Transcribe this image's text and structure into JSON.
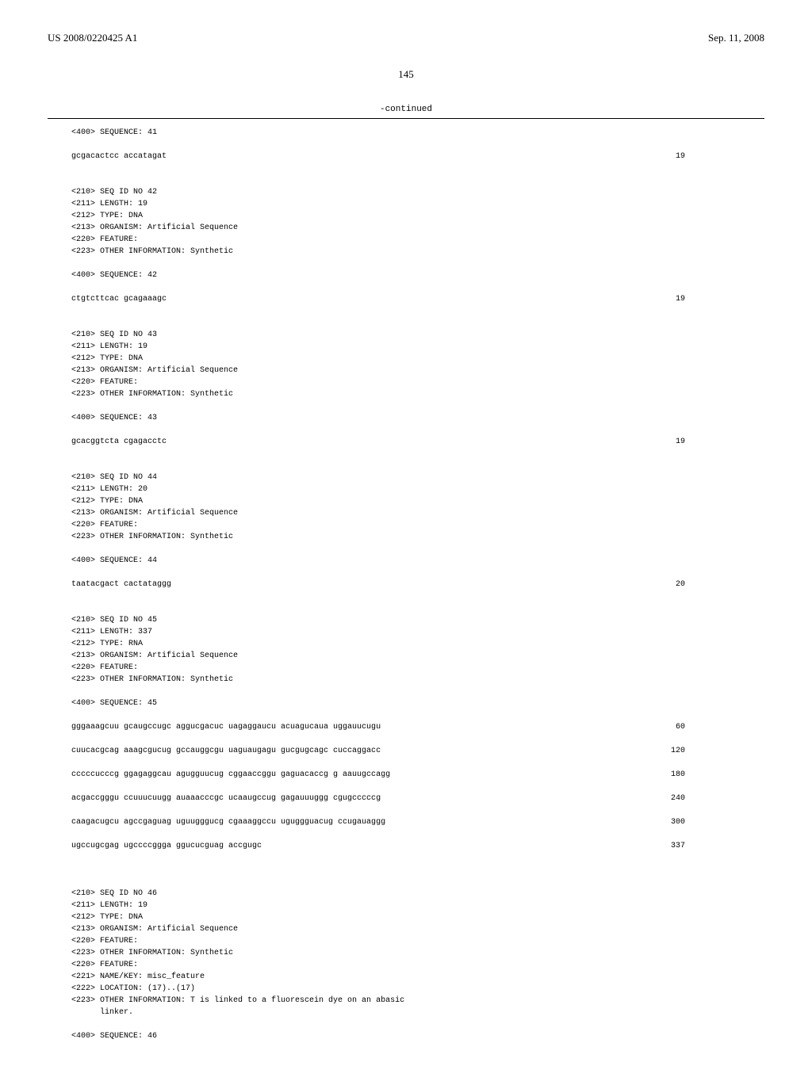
{
  "header": {
    "left": "US 2008/0220425 A1",
    "right": "Sep. 11, 2008"
  },
  "page_number": "145",
  "continued_label": "-continued",
  "sequences": [
    {
      "header_lines": [
        "<400> SEQUENCE: 41"
      ],
      "data": "gcgacactcc accatagat",
      "position": "19"
    },
    {
      "header_lines": [
        "<210> SEQ ID NO 42",
        "<211> LENGTH: 19",
        "<212> TYPE: DNA",
        "<213> ORGANISM: Artificial Sequence",
        "<220> FEATURE:",
        "<223> OTHER INFORMATION: Synthetic",
        "",
        "<400> SEQUENCE: 42"
      ],
      "data": "ctgtcttcac gcagaaagc",
      "position": "19"
    },
    {
      "header_lines": [
        "<210> SEQ ID NO 43",
        "<211> LENGTH: 19",
        "<212> TYPE: DNA",
        "<213> ORGANISM: Artificial Sequence",
        "<220> FEATURE:",
        "<223> OTHER INFORMATION: Synthetic",
        "",
        "<400> SEQUENCE: 43"
      ],
      "data": "gcacggtcta cgagacctc",
      "position": "19"
    },
    {
      "header_lines": [
        "<210> SEQ ID NO 44",
        "<211> LENGTH: 20",
        "<212> TYPE: DNA",
        "<213> ORGANISM: Artificial Sequence",
        "<220> FEATURE:",
        "<223> OTHER INFORMATION: Synthetic",
        "",
        "<400> SEQUENCE: 44"
      ],
      "data": "taatacgact cactataggg",
      "position": "20"
    },
    {
      "header_lines": [
        "<210> SEQ ID NO 45",
        "<211> LENGTH: 337",
        "<212> TYPE: RNA",
        "<213> ORGANISM: Artificial Sequence",
        "<220> FEATURE:",
        "<223> OTHER INFORMATION: Synthetic",
        "",
        "<400> SEQUENCE: 45"
      ],
      "multi_data": [
        {
          "text": "gggaaagcuu gcaugccugc aggucgacuc uagaggaucu acuagucaua uggauucugu",
          "pos": "60"
        },
        {
          "text": "cuucacgcag aaagcgucug gccauggcgu uaguaugagu gucgugcagc cuccaggacc",
          "pos": "120"
        },
        {
          "text": "cccccucccg ggagaggcau agugguucug cggaaccggu gaguacaccg g aauugccagg",
          "pos": "180"
        },
        {
          "text": "acgaccgggu ccuuucuugg auaaacccgc ucaaugccug gagauuuggg cgugcccccg",
          "pos": "240"
        },
        {
          "text": "caagacugcu agccgaguag uguugggucg cgaaaggccu uguggguacug ccugauaggg",
          "pos": "300"
        },
        {
          "text": "ugccugcgag ugccccggga ggucucguag accgugc",
          "pos": "337"
        }
      ]
    },
    {
      "header_lines": [
        "<210> SEQ ID NO 46",
        "<211> LENGTH: 19",
        "<212> TYPE: DNA",
        "<213> ORGANISM: Artificial Sequence",
        "<220> FEATURE:",
        "<223> OTHER INFORMATION: Synthetic",
        "<220> FEATURE:",
        "<221> NAME/KEY: misc_feature",
        "<222> LOCATION: (17)..(17)",
        "<223> OTHER INFORMATION: T is linked to a fluorescein dye on an abasic",
        "      linker.",
        "",
        "<400> SEQUENCE: 46"
      ]
    }
  ]
}
